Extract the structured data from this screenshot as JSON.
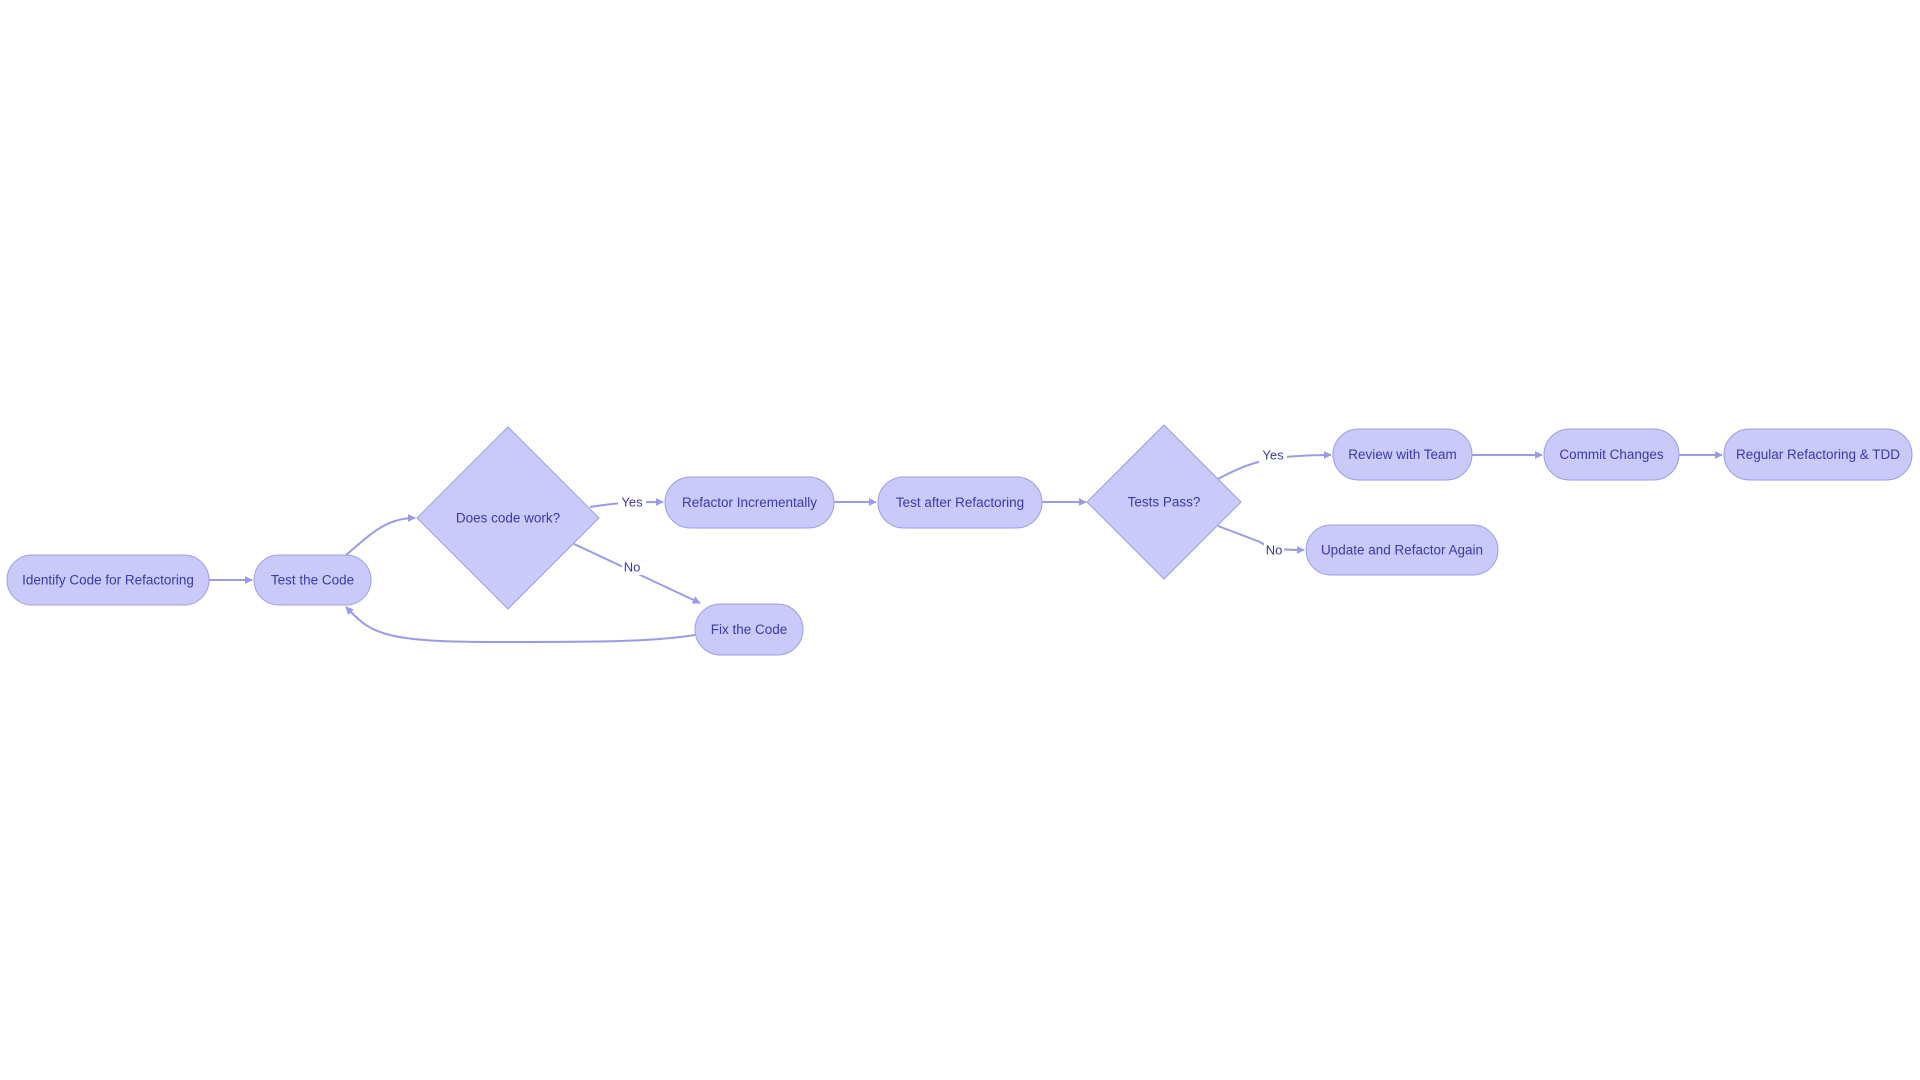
{
  "diagram": {
    "type": "flowchart",
    "direction": "left-to-right",
    "colors": {
      "node_fill": "#c9c9fa",
      "node_stroke": "#9c9ce6",
      "edge": "#9a9ae8",
      "text": "#3a3aa8",
      "background": "#ffffff"
    },
    "nodes": [
      {
        "id": "identify",
        "label": "Identify Code for Refactoring",
        "shape": "stadium"
      },
      {
        "id": "test",
        "label": "Test the Code",
        "shape": "stadium"
      },
      {
        "id": "works",
        "label": "Does code work?",
        "shape": "diamond"
      },
      {
        "id": "refactor",
        "label": "Refactor Incrementally",
        "shape": "stadium"
      },
      {
        "id": "fix",
        "label": "Fix the Code",
        "shape": "stadium"
      },
      {
        "id": "testafter",
        "label": "Test after Refactoring",
        "shape": "stadium"
      },
      {
        "id": "pass",
        "label": "Tests Pass?",
        "shape": "diamond"
      },
      {
        "id": "review",
        "label": "Review with Team",
        "shape": "stadium"
      },
      {
        "id": "update",
        "label": "Update and Refactor Again",
        "shape": "stadium"
      },
      {
        "id": "commit",
        "label": "Commit Changes",
        "shape": "stadium"
      },
      {
        "id": "regular",
        "label": "Regular Refactoring & TDD",
        "shape": "stadium"
      }
    ],
    "edges": [
      {
        "from": "identify",
        "to": "test",
        "label": ""
      },
      {
        "from": "test",
        "to": "works",
        "label": ""
      },
      {
        "from": "works",
        "to": "refactor",
        "label": "Yes"
      },
      {
        "from": "works",
        "to": "fix",
        "label": "No"
      },
      {
        "from": "fix",
        "to": "test",
        "label": ""
      },
      {
        "from": "refactor",
        "to": "testafter",
        "label": ""
      },
      {
        "from": "testafter",
        "to": "pass",
        "label": ""
      },
      {
        "from": "pass",
        "to": "review",
        "label": "Yes"
      },
      {
        "from": "pass",
        "to": "update",
        "label": "No"
      },
      {
        "from": "review",
        "to": "commit",
        "label": ""
      },
      {
        "from": "commit",
        "to": "regular",
        "label": ""
      }
    ]
  }
}
